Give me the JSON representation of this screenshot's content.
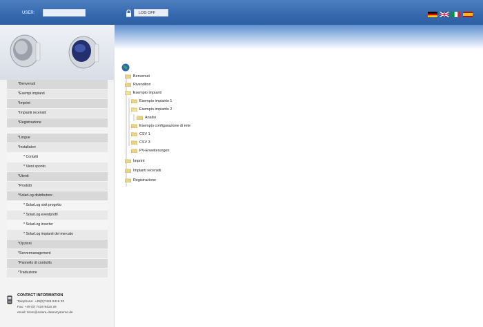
{
  "header": {
    "user_label": "USER:",
    "user_value": "",
    "logoff_label": "LOG OFF",
    "flags": [
      {
        "name": "german-flag-icon",
        "colors": [
          "#000000",
          "#dd0000",
          "#ffcc00"
        ]
      },
      {
        "name": "uk-flag-icon",
        "colors": [
          "#012169",
          "#ffffff",
          "#c8102e"
        ]
      },
      {
        "name": "italian-flag-icon",
        "colors": [
          "#009246",
          "#ffffff",
          "#ce2b37"
        ]
      },
      {
        "name": "spanish-flag-icon",
        "colors": [
          "#aa151b",
          "#f1bf00",
          "#aa151b"
        ]
      }
    ]
  },
  "sidebar": {
    "items": [
      {
        "label": "*Benvenuti"
      },
      {
        "label": "*Esempi impianti"
      },
      {
        "label": "*Imprint"
      },
      {
        "label": "*Impianti recensiti"
      },
      {
        "label": "*Registrazione"
      },
      {
        "label": "*Lingue"
      },
      {
        "label": "*Installatori"
      },
      {
        "label": "* Contatti"
      },
      {
        "label": "* Vieni sponto"
      },
      {
        "label": "*Utenti"
      },
      {
        "label": "*Prodotti"
      },
      {
        "label": "*SolarLog distributore"
      },
      {
        "label": "* SolarLog visit progetto"
      },
      {
        "label": "* SolarLog eventprofil"
      },
      {
        "label": "* SolarLog inverter"
      },
      {
        "label": "* SolarLog impianti del mercato"
      },
      {
        "label": "*Opzioni"
      },
      {
        "label": "*Servermanagement"
      },
      {
        "label": "*Pannello di controllo"
      },
      {
        "label": "*Traduzione"
      }
    ]
  },
  "contact": {
    "title": "CONTACT INFORMATION",
    "phone": "Telephone: +49(0)7428 9418 20",
    "fax": "Fax: +49 (0) 7428 9418 28",
    "email": "email: timm@solare-datensysteme.de"
  },
  "tree": {
    "items": [
      {
        "label": "Benvenuti"
      },
      {
        "label": "Rivenditori"
      },
      {
        "label": "Esempio impianti"
      },
      {
        "label": "Esempio impianto 1"
      },
      {
        "label": "Esempio impianto 2"
      },
      {
        "label": "Analisi"
      },
      {
        "label": "Esempio configurazione di rete"
      },
      {
        "label": "CSV 1"
      },
      {
        "label": "CSV 3"
      },
      {
        "label": "PV-Erweiterungen"
      },
      {
        "label": "Imprint"
      },
      {
        "label": "Impianti recensiti"
      },
      {
        "label": "Registrazione"
      }
    ]
  },
  "colors": {
    "header_blue": "#3568ad",
    "folder_yellow": "#e8d48a",
    "nav_gray": "#d8d8d8"
  }
}
